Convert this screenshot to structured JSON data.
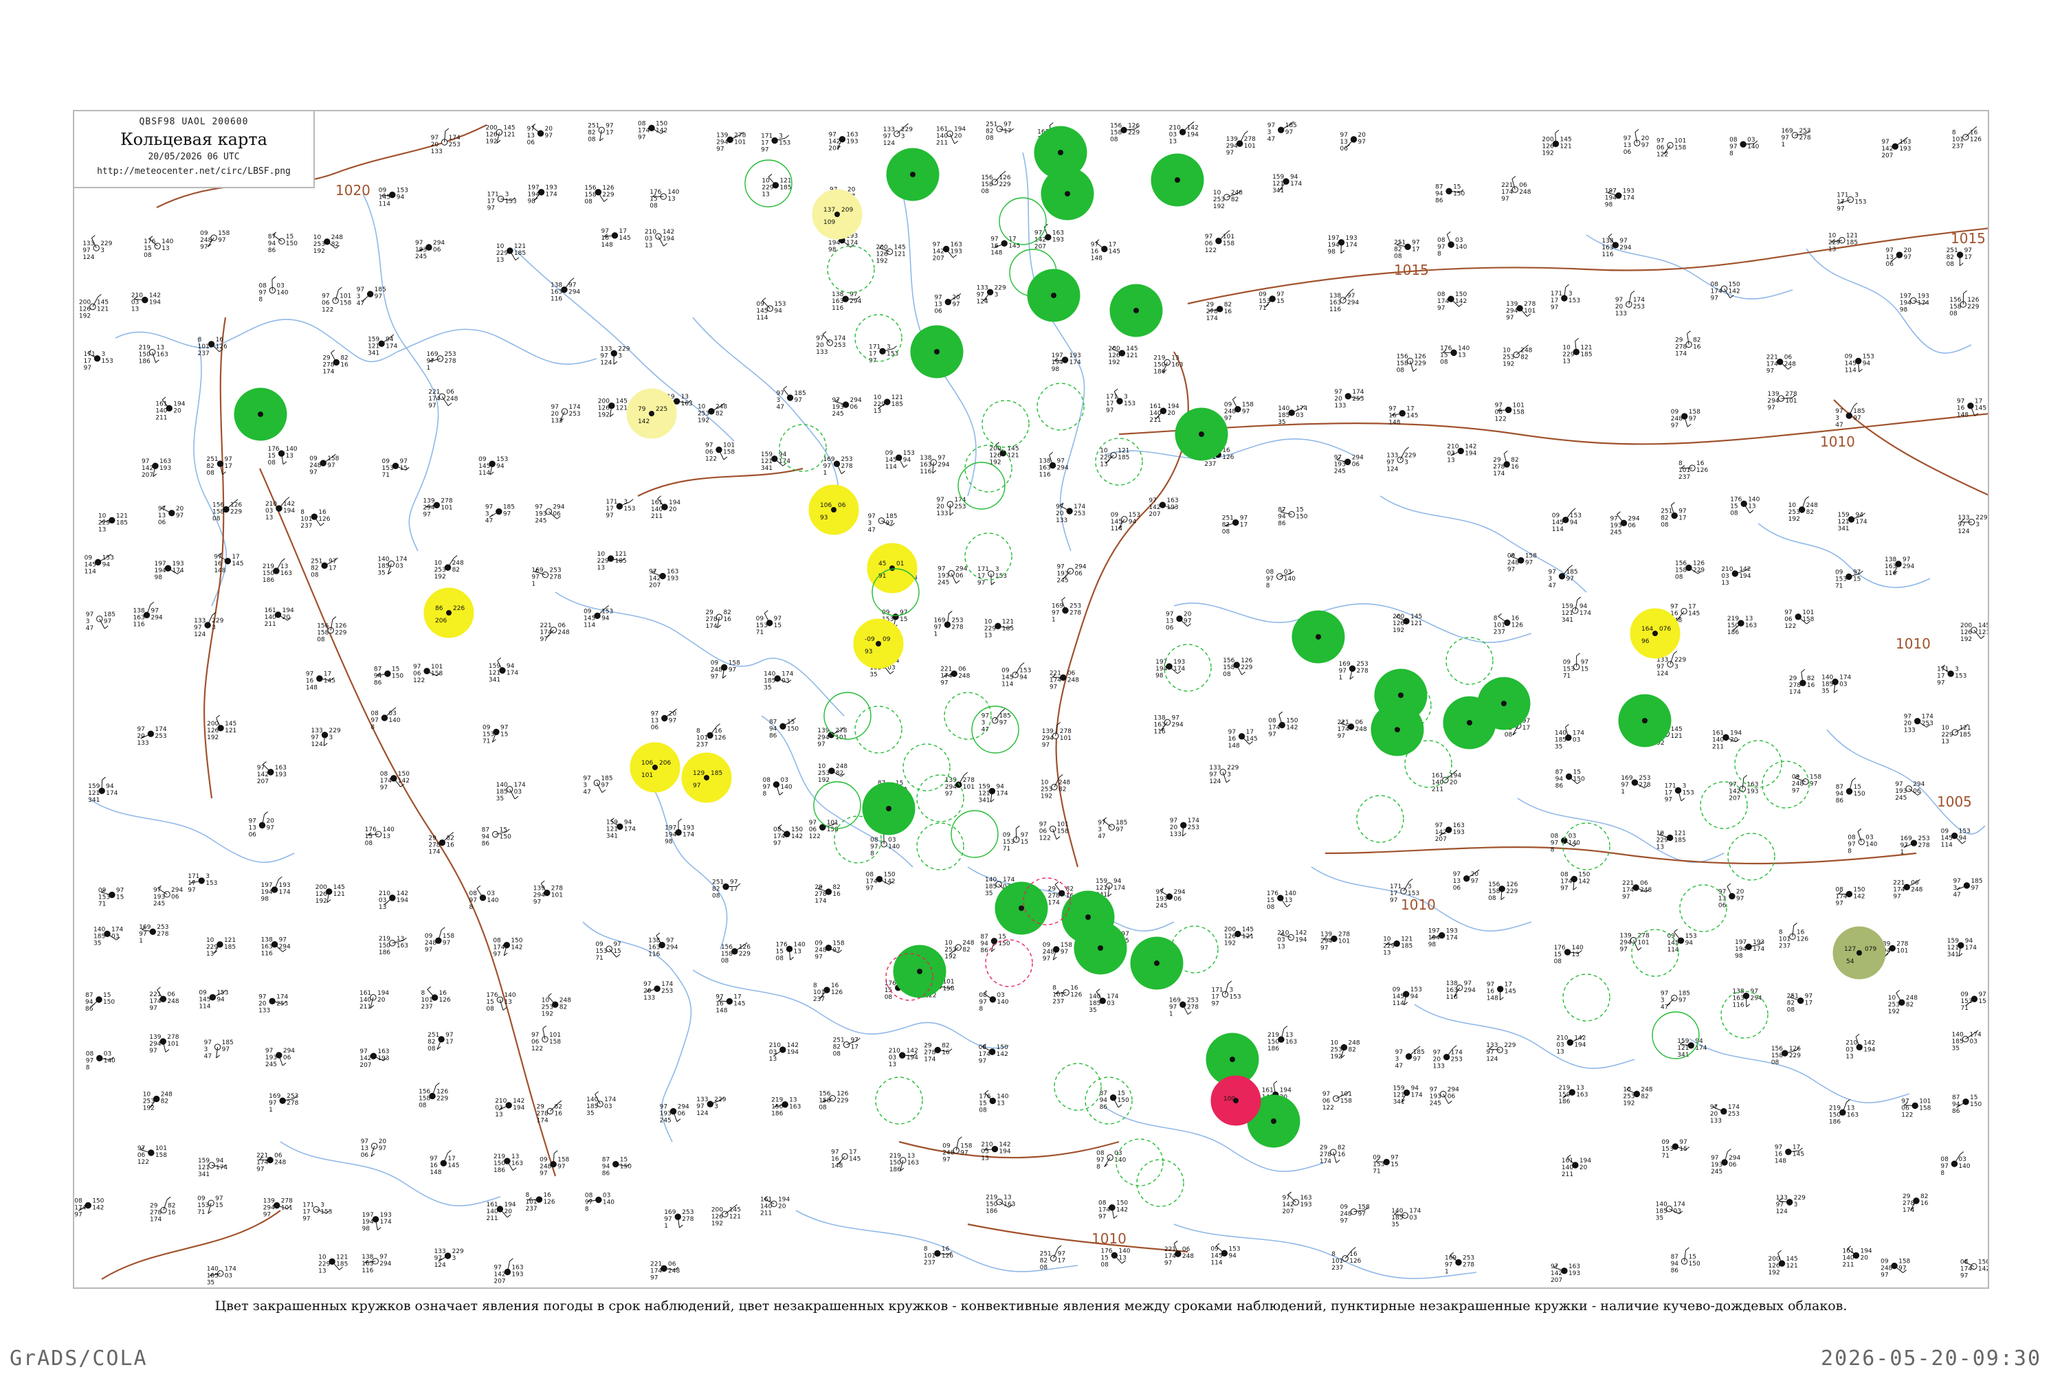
{
  "legend": {
    "code_line": "QBSF98  UAOL  200600",
    "title": "Кольцевая карта",
    "date_line": "20/05/2026 06 UTC",
    "url": "http://meteocenter.net/circ/LBSF.png"
  },
  "caption": "Цвет закрашенных кружков означает явления погоды в срок наблюдений, цвет незакрашенных кружков - конвективные явления между сроками наблюдений, пунктирные незакрашенные кружки - наличие кучево-дождевых облаков.",
  "footer": {
    "left": "GrADS/COLA",
    "right": "2026-05-20-09:30"
  },
  "isobars": {
    "color": "#a0522d",
    "labels": [
      "1020",
      "1015",
      "1015",
      "1010",
      "1010",
      "1010",
      "1005",
      "1010"
    ]
  },
  "colors": {
    "river": "#8fb8e8",
    "coast": "#8fb8e8",
    "isobar": "#a0522d",
    "rain_fill": "#22bb33",
    "rain_ring": "#22bb33",
    "fog_fill": "#f5f020",
    "fog_fill_light": "#f7f3a0",
    "thunder_fill": "#e8245a",
    "thunder_ring": "#e8245a",
    "olive_fill": "#a8b870"
  },
  "stations": {
    "filled_green": [
      {
        "n": "1",
        "t": "",
        "v": ""
      },
      {
        "n": "2",
        "t": "",
        "v": ""
      },
      {
        "n": "3",
        "t": "",
        "v": ""
      },
      {
        "n": "4",
        "t": "",
        "v": ""
      },
      {
        "n": "5",
        "t": "",
        "v": ""
      },
      {
        "n": "6",
        "t": "",
        "v": ""
      },
      {
        "n": "7",
        "t": "",
        "v": ""
      },
      {
        "n": "8",
        "t": "",
        "v": ""
      },
      {
        "n": "9",
        "t": "",
        "v": ""
      },
      {
        "n": "10",
        "t": "",
        "v": ""
      },
      {
        "n": "11",
        "t": "",
        "v": ""
      },
      {
        "n": "12",
        "t": "",
        "v": ""
      },
      {
        "n": "13",
        "t": "",
        "v": ""
      },
      {
        "n": "14",
        "t": "",
        "v": ""
      },
      {
        "n": "15",
        "t": "",
        "v": ""
      },
      {
        "n": "16",
        "t": "",
        "v": ""
      },
      {
        "n": "17",
        "t": "",
        "v": ""
      },
      {
        "n": "18",
        "t": "",
        "v": ""
      },
      {
        "n": "19",
        "t": "",
        "v": ""
      },
      {
        "n": "20",
        "t": "",
        "v": ""
      },
      {
        "n": "21",
        "t": "",
        "v": ""
      },
      {
        "n": "22",
        "t": "",
        "v": ""
      },
      {
        "n": "23",
        "t": "",
        "v": ""
      }
    ],
    "filled_yellow": [
      {
        "p": "209",
        "t": "137",
        "d": "109"
      },
      {
        "p": "225",
        "t": "79",
        "d": "142"
      },
      {
        "p": "226",
        "t": "86",
        "d": "206"
      },
      {
        "p": "06",
        "t": "106",
        "d": "93"
      },
      {
        "p": "01",
        "t": "45",
        "d": "91"
      },
      {
        "p": "09",
        "t": "-09",
        "d": "93"
      },
      {
        "p": "206",
        "t": "106",
        "d": "101"
      },
      {
        "p": "185",
        "t": "129",
        "d": "97"
      },
      {
        "p": "076",
        "t": "164",
        "d": "96"
      }
    ],
    "filled_red": [
      {
        "p": "",
        "t": "100",
        "d": ""
      }
    ],
    "filled_olive": [
      {
        "p": "079",
        "t": "127",
        "d": "54"
      }
    ]
  },
  "sample_values": [
    "133",
    "97",
    "124",
    "200",
    "126",
    "192",
    "171",
    "17",
    "97",
    "10",
    "229",
    "13",
    "09",
    "145",
    "114",
    "97",
    "3",
    "47",
    "159",
    "121",
    "341",
    "09",
    "153",
    "71",
    "140",
    "185",
    "35",
    "87",
    "94",
    "86",
    "08",
    "97",
    "8",
    "08",
    "174",
    "97",
    "176",
    "15",
    "08",
    "210",
    "03",
    "13",
    "219",
    "150",
    "186",
    "161",
    "140",
    "211",
    "97",
    "142",
    "207",
    "97",
    "13",
    "06",
    "197",
    "194",
    "98",
    "138",
    "163",
    "116",
    "97",
    "20",
    "133",
    "97",
    "193",
    "245",
    "169",
    "97",
    "1",
    "221",
    "174",
    "97",
    "139",
    "294",
    "97",
    "10",
    "253",
    "192",
    "97",
    "06",
    "122",
    "29",
    "278",
    "174",
    "09",
    "248",
    "97",
    "8",
    "101",
    "237",
    "251",
    "82",
    "08",
    "156",
    "158",
    "08",
    "97",
    "16",
    "148"
  ]
}
